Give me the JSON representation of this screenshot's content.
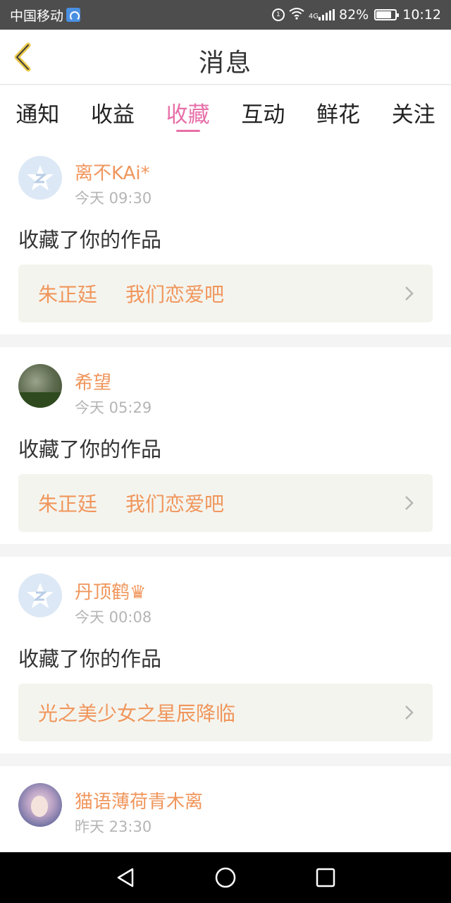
{
  "status_bar": {
    "carrier": "中国移动",
    "network_tag": "4G",
    "battery": "82%",
    "battery_level": 0.82,
    "time": "10:12"
  },
  "header": {
    "title": "消息",
    "back_icon": "chevron-left-icon"
  },
  "tabs": [
    {
      "label": "通知",
      "active": false
    },
    {
      "label": "收益",
      "active": false
    },
    {
      "label": "收藏",
      "active": true
    },
    {
      "label": "互动",
      "active": false
    },
    {
      "label": "鲜花",
      "active": false
    },
    {
      "label": "关注",
      "active": false
    }
  ],
  "messages": [
    {
      "user": "离不KAi*",
      "time": "今天 09:30",
      "action": "收藏了你的作品",
      "work_author": "朱正廷",
      "work_title": "我们恋爱吧",
      "avatar": "default-avatar"
    },
    {
      "user": "希望",
      "time": "今天 05:29",
      "action": "收藏了你的作品",
      "work_author": "朱正廷",
      "work_title": "我们恋爱吧",
      "avatar": "photo-avatar"
    },
    {
      "user": "丹顶鹤♛",
      "time": "今天 00:08",
      "action": "收藏了你的作品",
      "work_author": "光之美少女之星辰降临",
      "work_title": "",
      "avatar": "default-avatar"
    },
    {
      "user": "猫语薄荷青木离",
      "time": "昨天 23:30",
      "avatar": "photo-avatar"
    }
  ],
  "colors": {
    "accent": "#e76fa8",
    "name_orange": "#f0965c",
    "work_box_bg": "#f4f4ee",
    "status_bar_bg": "#4d4d4d"
  }
}
